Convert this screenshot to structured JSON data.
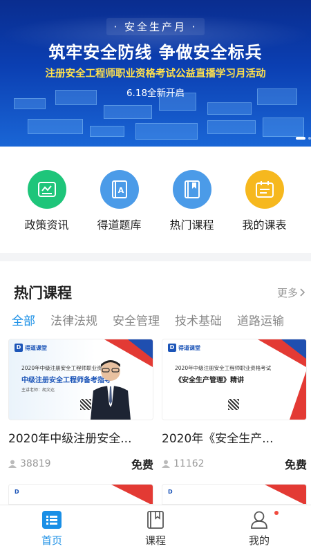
{
  "banner": {
    "month": "· 安全生产月 ·",
    "headline": "筑牢安全防线  争做安全标兵",
    "subtitle": "注册安全工程师职业资格考试公益直播学习月活动",
    "date": "6.18全新开启"
  },
  "quick_menu": [
    {
      "label": "政策资讯",
      "icon": "news-icon",
      "color": "#1ec57a"
    },
    {
      "label": "得道题库",
      "icon": "question-bank-icon",
      "color": "#4b9be8"
    },
    {
      "label": "热门课程",
      "icon": "book-icon",
      "color": "#4b9be8"
    },
    {
      "label": "我的课表",
      "icon": "schedule-icon",
      "color": "#f6b81e"
    }
  ],
  "hot": {
    "title": "热门课程",
    "more": "更多",
    "categories": [
      "全部",
      "法律法规",
      "安全管理",
      "技术基础",
      "道路运输"
    ],
    "courses": [
      {
        "title": "2020年中级注册安全...",
        "views": "38819",
        "price": "免费",
        "thumb_logo": "得道课堂",
        "thumb_line1": "2020年中级注册安全工程师职业资格考试",
        "thumb_line2": "中级注册安全工程师备考指导",
        "thumb_teacher": "主讲老师：胡文达"
      },
      {
        "title": "2020年《安全生产...",
        "views": "11162",
        "price": "免费",
        "thumb_logo": "得道课堂",
        "thumb_line1": "2020年中级注册安全工程师职业资格考试",
        "thumb_line2": "《安全生产管理》精讲",
        "thumb_teacher": ""
      }
    ]
  },
  "tabbar": {
    "tabs": [
      {
        "label": "首页",
        "icon": "home-icon"
      },
      {
        "label": "课程",
        "icon": "course-icon"
      },
      {
        "label": "我的",
        "icon": "profile-icon"
      }
    ],
    "accent": "#1a8fe6"
  }
}
